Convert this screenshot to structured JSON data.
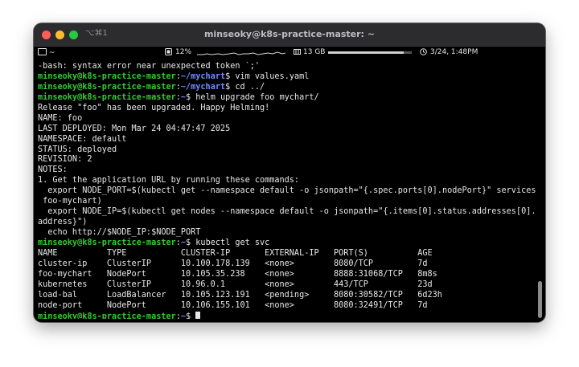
{
  "window": {
    "shortcut": "⌥⌘1",
    "title": "minseoky@k8s-practice-master: ~"
  },
  "statusbar": {
    "folder_text": "~",
    "cpu": "12%",
    "memory": "13 GB",
    "memory_used_fraction": 0.9,
    "clock": "3/24, 1:48PM",
    "icons": [
      "folder-icon",
      "cpu-icon",
      "memory-icon",
      "clock-icon"
    ]
  },
  "terminal": {
    "lines": [
      {
        "text": "-bash: syntax error near unexpected token `;'"
      },
      {
        "user": "minseoky@k8s-practice-master",
        "path": "~/mychart",
        "cmd": "$ vim values.yaml"
      },
      {
        "user": "minseoky@k8s-practice-master",
        "path": "~/mychart",
        "cmd": "$ cd ../"
      },
      {
        "user": "minseoky@k8s-practice-master",
        "path": "~",
        "cmd": "$ helm upgrade foo mychart/"
      },
      {
        "text": "Release \"foo\" has been upgraded. Happy Helming!"
      },
      {
        "text": "NAME: foo"
      },
      {
        "text": "LAST DEPLOYED: Mon Mar 24 04:47:47 2025"
      },
      {
        "text": "NAMESPACE: default"
      },
      {
        "text": "STATUS: deployed"
      },
      {
        "text": "REVISION: 2"
      },
      {
        "text": "NOTES:"
      },
      {
        "text": "1. Get the application URL by running these commands:"
      },
      {
        "text": "  export NODE_PORT=$(kubectl get --namespace default -o jsonpath=\"{.spec.ports[0].nodePort}\" services"
      },
      {
        "text": " foo-mychart)"
      },
      {
        "text": "  export NODE_IP=$(kubectl get nodes --namespace default -o jsonpath=\"{.items[0].status.addresses[0]."
      },
      {
        "text": "address}\")"
      },
      {
        "text": "  echo http://$NODE_IP:$NODE_PORT"
      },
      {
        "user": "minseoky@k8s-practice-master",
        "path": "~",
        "cmd": "$ kubectl get svc"
      },
      {
        "text": "NAME          TYPE           CLUSTER-IP       EXTERNAL-IP   PORT(S)          AGE"
      },
      {
        "text": "cluster-ip    ClusterIP      10.100.178.139   <none>        8080/TCP         7d"
      },
      {
        "text": "foo-mychart   NodePort       10.105.35.238    <none>        8888:31068/TCP   8m8s"
      },
      {
        "text": "kubernetes    ClusterIP      10.96.0.1        <none>        443/TCP          23d"
      },
      {
        "text": "load-bal      LoadBalancer   10.105.123.191   <pending>     8080:30582/TCP   6d23h"
      },
      {
        "text": "node-port     NodePort       10.106.155.101   <none>        8080:32491/TCP   7d"
      },
      {
        "user": "minseoky@k8s-practice-master",
        "path": "~",
        "cmd": "$ ",
        "cursor": true
      }
    ]
  }
}
